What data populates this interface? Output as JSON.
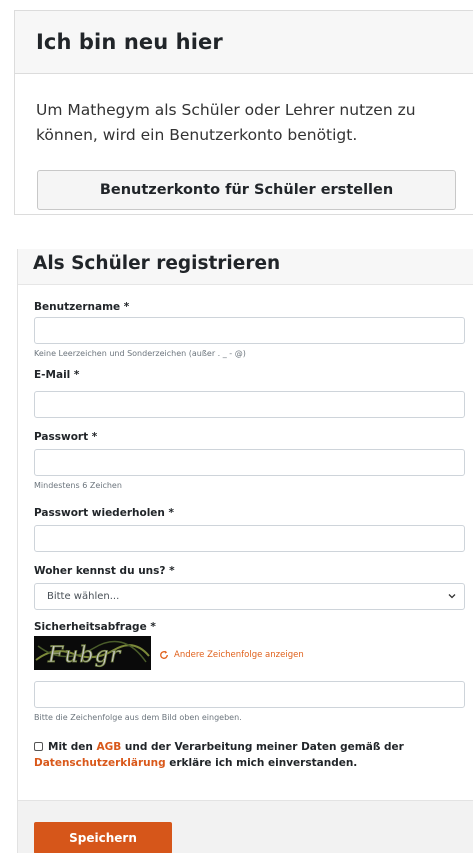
{
  "intro_card": {
    "title": "Ich bin neu hier",
    "text": "Um Mathegym als Schüler oder Lehrer nutzen zu können, wird ein Benutzerkonto benötigt.",
    "create_button": "Benutzerkonto für Schüler erstellen"
  },
  "register_form": {
    "title": "Als Schüler registrieren",
    "username": {
      "label": "Benutzername *",
      "value": "",
      "help": "Keine Leerzeichen und Sonderzeichen (außer . _ - @)"
    },
    "email": {
      "label": "E-Mail *",
      "value": ""
    },
    "password": {
      "label": "Passwort *",
      "value": "",
      "help": "Mindestens 6 Zeichen"
    },
    "password_repeat": {
      "label": "Passwort wiederholen *",
      "value": ""
    },
    "source": {
      "label": "Woher kennst du uns? *",
      "selected": "Bitte wählen..."
    },
    "captcha": {
      "label": "Sicherheitsabfrage *",
      "image_text": "Fubgr",
      "refresh_link": "Andere Zeichenfolge anzeigen",
      "value": "",
      "help": "Bitte die Zeichenfolge aus dem Bild oben eingeben."
    },
    "agb": {
      "checked": false,
      "text_1": "Mit den ",
      "link_agb": "AGB",
      "text_2": " und der Verarbeitung meiner Daten gemäß der ",
      "link_privacy": "Datenschutzerklärung",
      "text_3": " erkläre ich mich einverstanden."
    },
    "save_button": "Speichern"
  },
  "colors": {
    "accent": "#d6561a",
    "link": "#d9581a",
    "header_bg": "#f7f7f7"
  }
}
